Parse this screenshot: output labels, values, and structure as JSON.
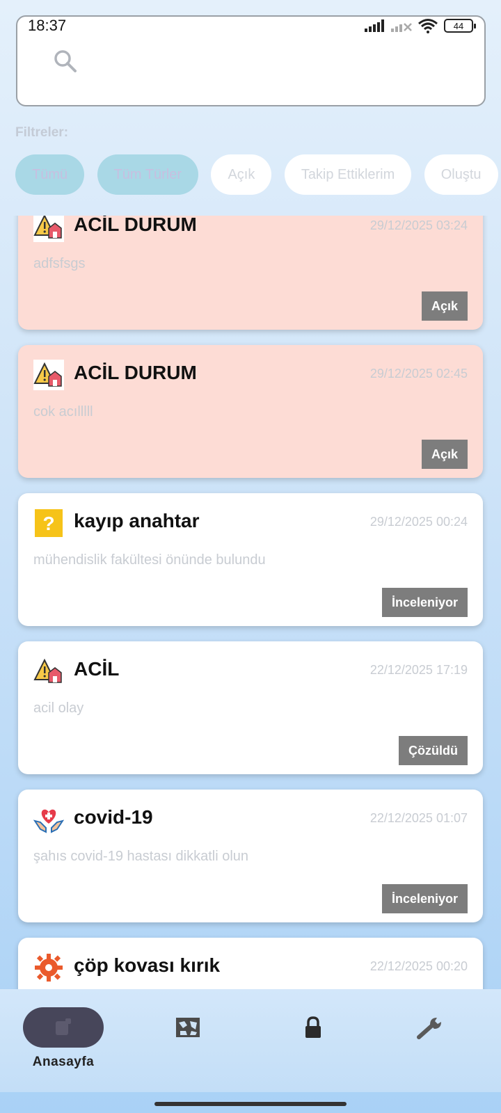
{
  "status_bar": {
    "time": "18:37",
    "battery": "44"
  },
  "search": {
    "placeholder": ""
  },
  "filters": {
    "label": "Filtreler:",
    "chips": [
      {
        "label": "Tümü",
        "active": true
      },
      {
        "label": "Tüm Türler",
        "active": true
      },
      {
        "label": "Açık",
        "active": false
      },
      {
        "label": "Takip Ettiklerim",
        "active": false
      },
      {
        "label": "Oluştu",
        "active": false
      }
    ]
  },
  "cards": [
    {
      "icon": "emergency-alert-icon",
      "title": "ACİL DURUM",
      "date": "29/12/2025 03:24",
      "desc": "adfsfsgs",
      "status": "Açık",
      "bg": "#fddcd5"
    },
    {
      "icon": "emergency-alert-icon",
      "title": "ACİL DURUM",
      "date": "29/12/2025 02:45",
      "desc": "cok acılllll",
      "status": "Açık",
      "bg": "#fddcd5"
    },
    {
      "icon": "question-icon",
      "title": "kayıp anahtar",
      "date": "29/12/2025 00:24",
      "desc": "mühendislik fakültesi önünde bulundu",
      "status": "İnceleniyor",
      "bg": "#ffffff"
    },
    {
      "icon": "emergency-alert-icon",
      "title": "ACİL",
      "date": "22/12/2025 17:19",
      "desc": "acil olay",
      "status": "Çözüldü",
      "bg": "#ffffff"
    },
    {
      "icon": "health-care-icon",
      "title": "covid-19",
      "date": "22/12/2025 01:07",
      "desc": "şahıs covid-19 hastası dikkatli olun",
      "status": "İnceleniyor",
      "bg": "#ffffff"
    },
    {
      "icon": "gear-icon",
      "title": "çöp kovası kırık",
      "date": "22/12/2025 00:20",
      "desc": "",
      "status": "",
      "bg": "#ffffff"
    }
  ],
  "nav": {
    "home_label": "Anasayfa",
    "items": [
      "home-icon",
      "map-icon",
      "lock-icon",
      "wrench-icon"
    ]
  },
  "colors": {
    "accent_chip": "#a9d8e6",
    "badge": "#7d7d7d",
    "alert_card": "#fddcd5",
    "nav_pill": "#47465a"
  }
}
